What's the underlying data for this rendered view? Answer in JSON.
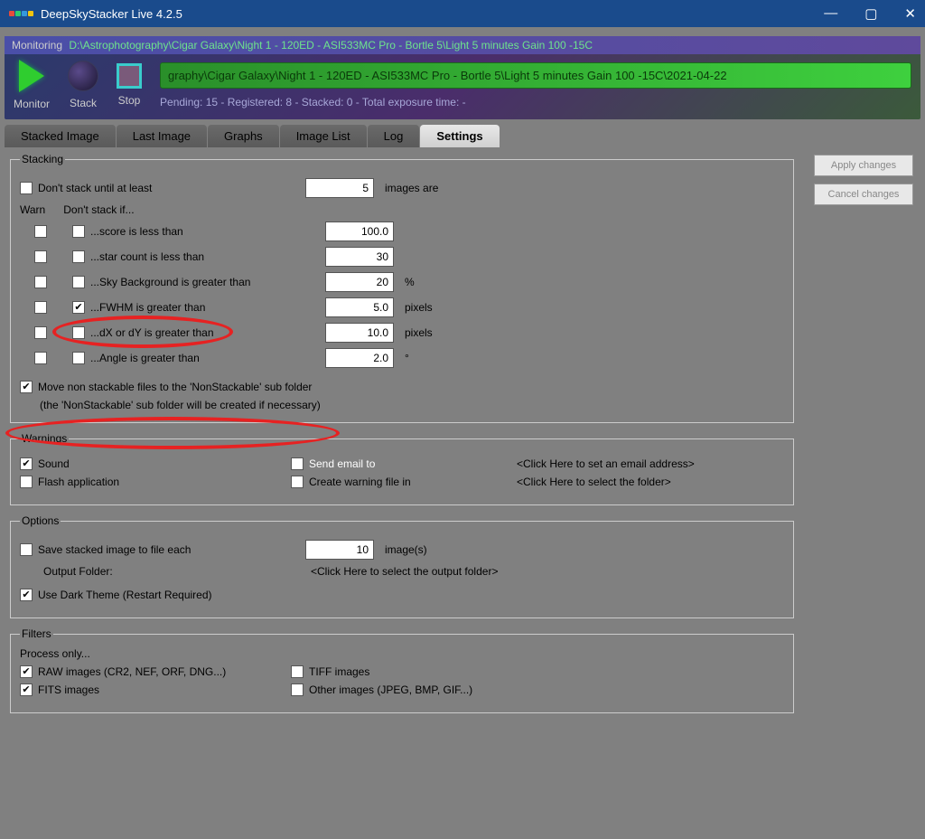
{
  "titlebar": {
    "title": "DeepSkyStacker Live 4.2.5"
  },
  "monitor": {
    "label": "Monitoring",
    "path": "D:\\Astrophotography\\Cigar Galaxy\\Night 1 - 120ED - ASI533MC Pro - Bortle 5\\Light 5 minutes Gain 100 -15C",
    "pathbar": "graphy\\Cigar Galaxy\\Night 1 - 120ED - ASI533MC Pro - Bortle 5\\Light 5 minutes Gain 100 -15C\\2021-04-22",
    "monitor_btn": "Monitor",
    "stack_btn": "Stack",
    "stop_btn": "Stop",
    "status": "Pending: 15 - Registered: 8 - Stacked: 0 - Total exposure time: -"
  },
  "tabs": {
    "stacked": "Stacked Image",
    "last": "Last Image",
    "graphs": "Graphs",
    "imagelist": "Image List",
    "log": "Log",
    "settings": "Settings"
  },
  "buttons": {
    "apply": "Apply changes",
    "cancel": "Cancel changes"
  },
  "stacking": {
    "legend": "Stacking",
    "dont_stack_until": "Don't stack until at least",
    "dont_stack_until_value": "5",
    "images_are": "images are",
    "warn": "Warn",
    "dont_stack_if": "Don't stack if...",
    "score_less": "...score is less than",
    "score_val": "100.0",
    "star_less": "...star count is less than",
    "star_val": "30",
    "skybg_greater": "...Sky Background is greater than",
    "skybg_val": "20",
    "skybg_unit": "%",
    "fwhm_greater": "...FWHM is greater than",
    "fwhm_val": "5.0",
    "fwhm_unit": "pixels",
    "dxdy_greater": "...dX or dY is greater than",
    "dxdy_val": "10.0",
    "dxdy_unit": "pixels",
    "angle_greater": "...Angle is greater than",
    "angle_val": "2.0",
    "angle_unit": "°",
    "move_non": "Move non stackable files to the 'NonStackable' sub folder",
    "move_note": "(the 'NonStackable' sub folder will be created if necessary)"
  },
  "warnings": {
    "legend": "Warnings",
    "sound": "Sound",
    "flash": "Flash application",
    "send_email": "Send email to",
    "email_placeholder": "<Click Here to set an email address>",
    "create_file": "Create warning file in",
    "file_placeholder": "<Click Here to select the folder>"
  },
  "options": {
    "legend": "Options",
    "save_each": "Save stacked image to file each",
    "save_val": "10",
    "save_unit": "image(s)",
    "output_folder": "Output Folder:",
    "output_placeholder": "<Click Here to select the output folder>",
    "dark_theme": "Use Dark Theme (Restart Required)"
  },
  "filters": {
    "legend": "Filters",
    "process_only": "Process only...",
    "raw": "RAW images (CR2, NEF, ORF, DNG...)",
    "fits": "FITS images",
    "tiff": "TIFF images",
    "other": "Other images (JPEG, BMP, GIF...)"
  }
}
